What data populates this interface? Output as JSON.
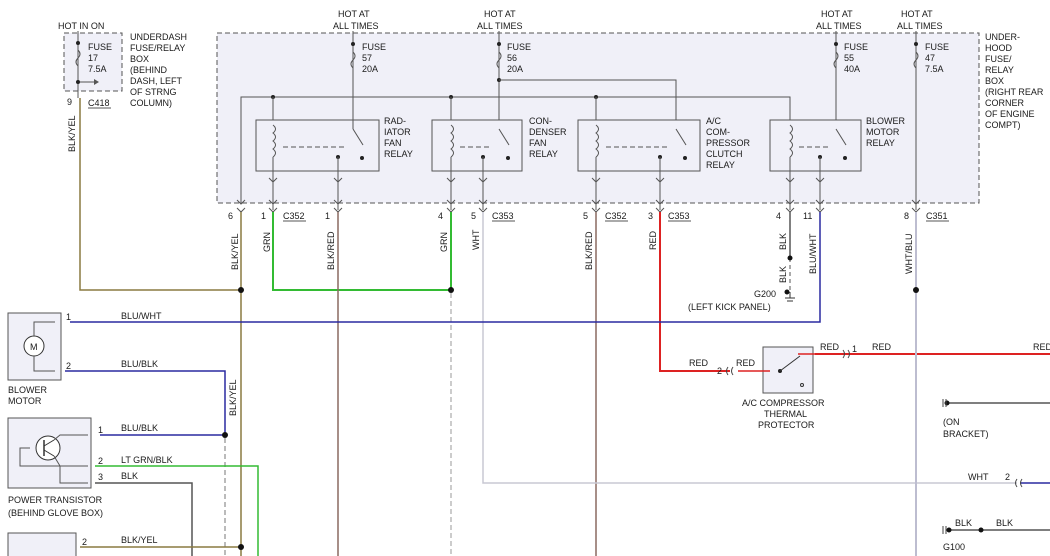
{
  "header": {
    "hot_in_on": "HOT IN ON",
    "hot_at_all_times_1": [
      "HOT AT",
      "ALL TIMES"
    ],
    "hot_at_all_times_2": [
      "HOT AT",
      "ALL TIMES"
    ],
    "hot_at_all_times_3": [
      "HOT AT",
      "ALL TIMES"
    ],
    "hot_at_all_times_4": [
      "HOT AT",
      "ALL TIMES"
    ]
  },
  "boxes": {
    "underdash": [
      "UNDERDASH",
      "FUSE/RELAY",
      "BOX",
      "(BEHIND",
      "DASH, LEFT",
      "OF STRNG",
      "COLUMN)"
    ],
    "underhood": [
      "UNDER-",
      "HOOD",
      "FUSE/",
      "RELAY",
      "BOX",
      "(RIGHT REAR",
      "CORNER",
      "OF ENGINE",
      "COMPT)"
    ]
  },
  "fuses": [
    {
      "lines": [
        "FUSE",
        "17",
        "7.5A"
      ]
    },
    {
      "lines": [
        "FUSE",
        "57",
        "20A"
      ]
    },
    {
      "lines": [
        "FUSE",
        "56",
        "20A"
      ]
    },
    {
      "lines": [
        "FUSE",
        "55",
        "40A"
      ]
    },
    {
      "lines": [
        "FUSE",
        "47",
        "7.5A"
      ]
    }
  ],
  "relays": [
    {
      "lines": [
        "RAD-",
        "IATOR",
        "FAN",
        "RELAY"
      ]
    },
    {
      "lines": [
        "CON-",
        "DENSER",
        "FAN",
        "RELAY"
      ]
    },
    {
      "lines": [
        "A/C",
        "COM-",
        "PRESSOR",
        "CLUTCH",
        "RELAY"
      ]
    },
    {
      "lines": [
        "BLOWER",
        "MOTOR",
        "RELAY"
      ]
    }
  ],
  "connectors": {
    "c418": "C418",
    "c352a": "C352",
    "c353a": "C353",
    "c352b": "C352",
    "c353b": "C353",
    "c351": "C351"
  },
  "pins": [
    "9",
    "6",
    "1",
    "1",
    "4",
    "5",
    "5",
    "3",
    "4",
    "11",
    "8"
  ],
  "wires": {
    "blk_yel_v1": "BLK/YEL",
    "blk_yel_v2": "BLK/YEL",
    "grn_v1": "GRN",
    "blk_red_v1": "BLK/RED",
    "grn_v2": "GRN",
    "wht_v1": "WHT",
    "blk_red_v2": "BLK/RED",
    "red_v1": "RED",
    "blk_v1": "BLK",
    "blk_v2": "BLK",
    "blu_wht_v1": "BLU/WHT",
    "wht_blu_v1": "WHT/BLU",
    "blk_yel_v3": "BLK/YEL",
    "blu_wht_h": "BLU/WHT",
    "blu_blk_h1": "BLU/BLK",
    "blu_blk_h2": "BLU/BLK",
    "lt_grn_blk_h": "LT GRN/BLK",
    "blk_h": "BLK",
    "blk_yel_h": "BLK/YEL",
    "red_h1": "RED",
    "red_h2": "RED",
    "red_h3": "RED",
    "red_h4": "RED",
    "red_h5": "RED",
    "wht_h": "WHT",
    "blk_h2": "BLK",
    "blk_h3": "BLK"
  },
  "components": {
    "g200": [
      "G200",
      "(LEFT KICK PANEL)"
    ],
    "blower_motor": [
      "BLOWER",
      "MOTOR"
    ],
    "power_transistor": [
      "POWER TRANSISTOR",
      "(BEHIND GLOVE BOX)"
    ],
    "ac_thermal": [
      "A/C COMPRESSOR",
      "THERMAL",
      "PROTECTOR"
    ],
    "on_bracket": [
      "(ON",
      "BRACKET)"
    ],
    "g100": "G100",
    "motor_symbol": "M"
  },
  "small_pins": {
    "bm1": "1",
    "bm2": "2",
    "pt1": "1",
    "pt2": "2",
    "pt3": "3",
    "bottom2": "2",
    "thp2": "2",
    "thp1": "1",
    "wht2": "2"
  },
  "colors": {
    "grn": "#33bb33",
    "red": "#dd2222",
    "blue": "#2a2aa0",
    "olive": "#8a7a40",
    "brown": "#8a6a60",
    "lightgray": "#bdbdd0",
    "blk": "#555555"
  }
}
